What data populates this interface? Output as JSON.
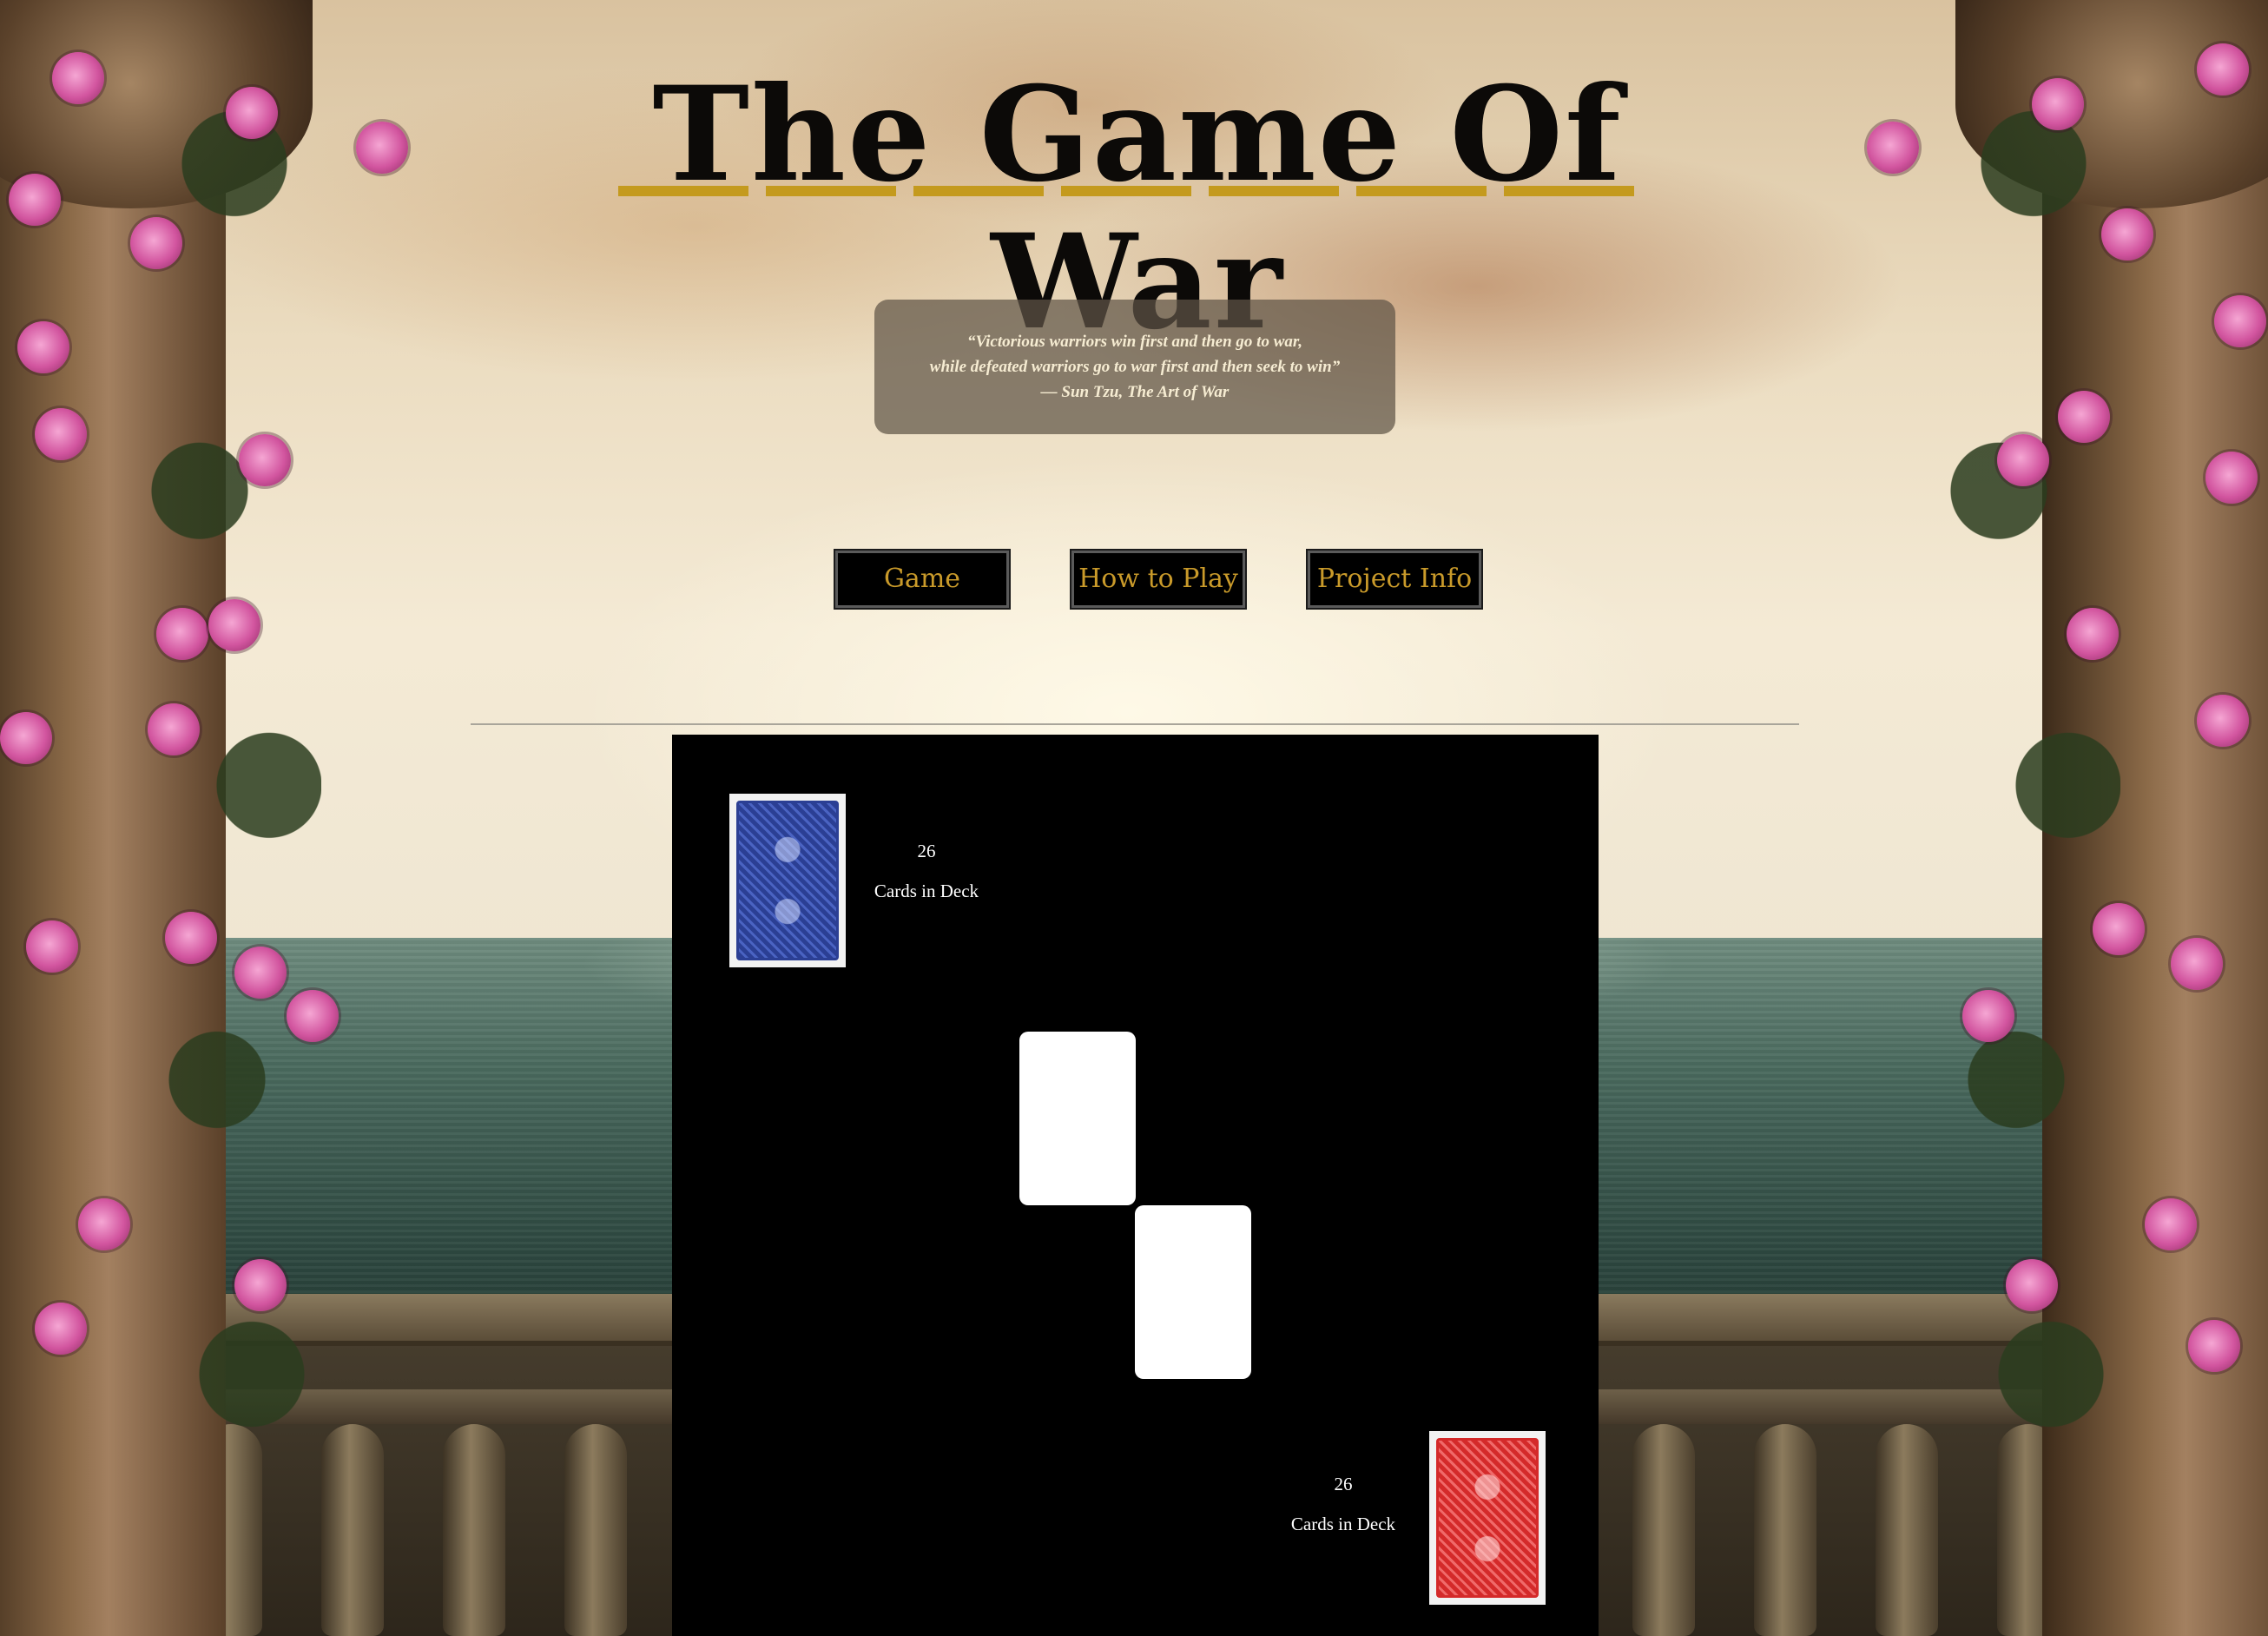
{
  "header": {
    "title": "The Game Of War",
    "quote": {
      "line1": "“Victorious warriors win first and then go to war,",
      "line2": "while defeated warriors go to war first and then seek to win”",
      "attribution": "— Sun Tzu, The Art of War"
    }
  },
  "nav": {
    "items": [
      {
        "label": "Game"
      },
      {
        "label": "How to Play"
      },
      {
        "label": "Project Info"
      }
    ]
  },
  "game": {
    "opponent": {
      "count": "26",
      "count_label": "Cards in Deck",
      "card_back_color": "#2b3f94"
    },
    "player": {
      "count": "26",
      "count_label": "Cards in Deck",
      "card_back_color": "#d42a2a"
    }
  },
  "colors": {
    "title_underline": "#c49a1e",
    "nav_text": "#c99a2a",
    "board_bg": "#000000"
  }
}
